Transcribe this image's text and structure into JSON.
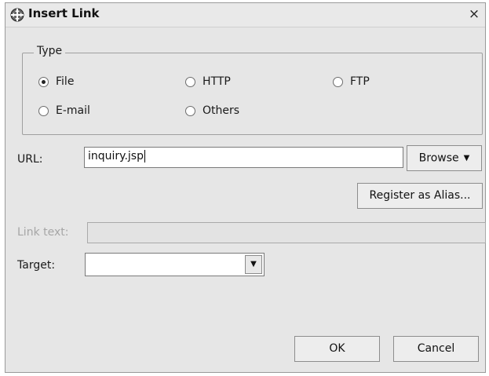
{
  "dialog": {
    "title": "Insert Link",
    "close_glyph": "×"
  },
  "type_group": {
    "legend": "Type",
    "options": [
      {
        "label": "File",
        "checked": true
      },
      {
        "label": "HTTP",
        "checked": false
      },
      {
        "label": "FTP",
        "checked": false
      },
      {
        "label": "E-mail",
        "checked": false
      },
      {
        "label": "Others",
        "checked": false
      }
    ]
  },
  "url": {
    "label": "URL:",
    "value": "inquiry.jsp",
    "browse_label": "Browse",
    "browse_arrow": "▼"
  },
  "register_alias_label": "Register as Alias...",
  "link_text": {
    "label": "Link text:",
    "value": ""
  },
  "target": {
    "label": "Target:",
    "value": "",
    "drop_arrow": "▼"
  },
  "buttons": {
    "ok": "OK",
    "cancel": "Cancel"
  }
}
